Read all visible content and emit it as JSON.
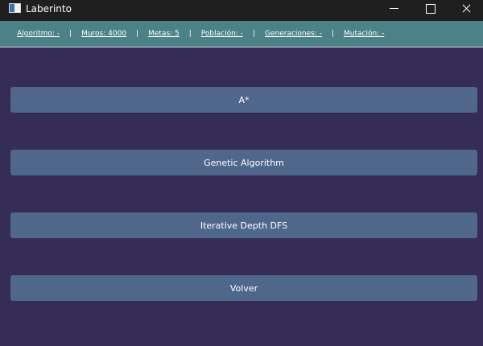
{
  "window": {
    "title": "Laberinto",
    "icon": "app-window-icon",
    "controls": [
      "minimize-icon",
      "maximize-icon",
      "close-icon"
    ]
  },
  "info": {
    "items": [
      "Algoritmo: -",
      "Muros: 4000",
      "Metas: 5",
      "Población: -",
      "Generaciones: -",
      "Mutación: -"
    ],
    "separator": "|"
  },
  "menu": {
    "buttons": [
      "A*",
      "Genetic Algorithm",
      "Iterative Depth DFS",
      "Volver"
    ]
  },
  "colors": {
    "background": "#352d55",
    "infobar": "#4b8288",
    "button": "#4f678a",
    "titlebar": "#1f1f1f"
  }
}
